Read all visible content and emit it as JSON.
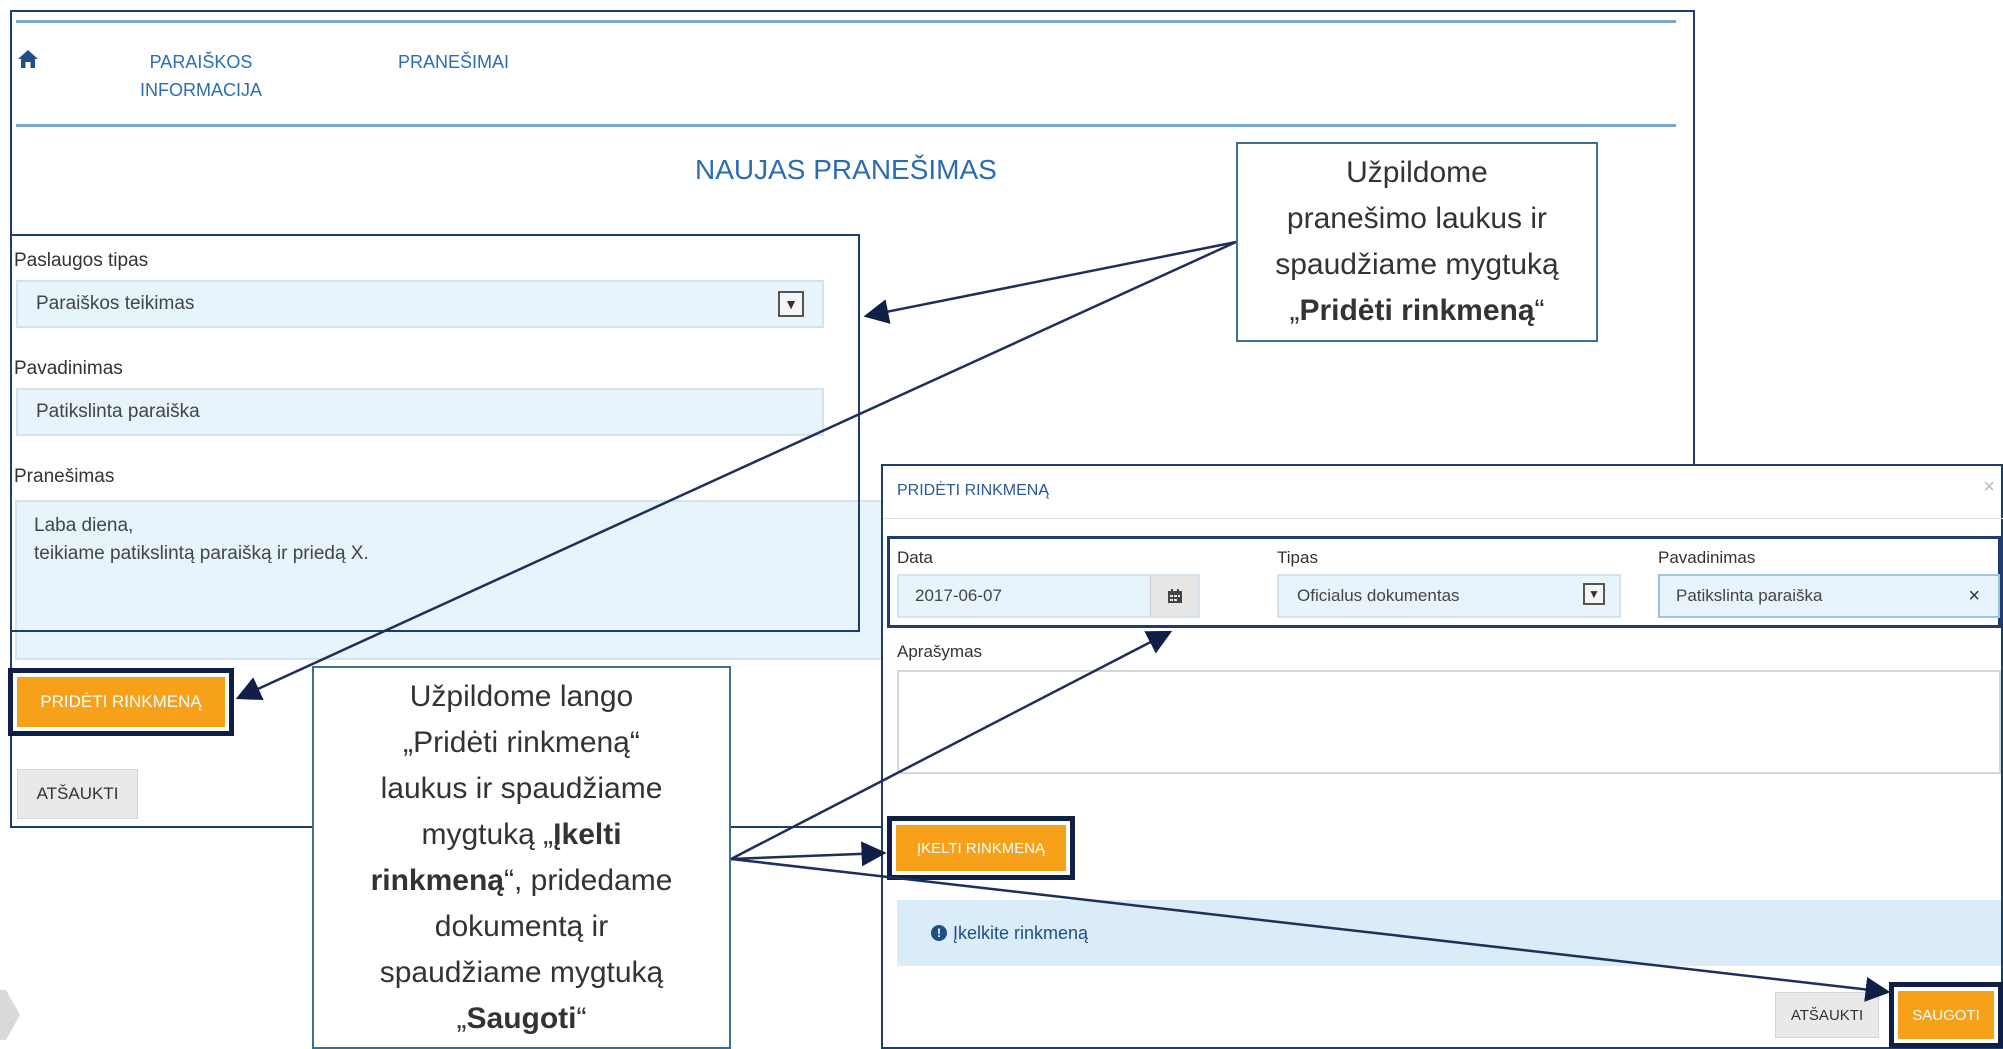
{
  "nav": {
    "home_icon": "home-icon",
    "items": [
      {
        "label_line1": "PARAIŠKOS",
        "label_line2": "INFORMACIJA"
      },
      {
        "label_line1": "PRANEŠIMAI"
      }
    ]
  },
  "page": {
    "title": "NAUJAS PRANEŠIMAS"
  },
  "form": {
    "service_type": {
      "label": "Paslaugos tipas",
      "value": "Paraiškos teikimas"
    },
    "name": {
      "label": "Pavadinimas",
      "value": "Patikslinta paraiška"
    },
    "message": {
      "label": "Pranešimas",
      "line1": "Laba diena,",
      "line2": "teikiame patikslintą paraišką ir priedą X."
    },
    "add_file_button": "PRIDĖTI RINKMENĄ",
    "cancel_button": "ATŠAUKTI"
  },
  "callouts": {
    "top": {
      "line1": "Užpildome",
      "line2": "pranešimo laukus ir",
      "line3": "spaudžiame mygtuką",
      "open_quote": "„",
      "bold": "Pridėti rinkmeną",
      "close_quote": "“"
    },
    "bottom": {
      "line1": "Užpildome lango",
      "line2": "„Pridėti rinkmeną“",
      "line3": "laukus ir spaudžiame",
      "line4_pre": "mygtuką „",
      "line4_bold": "Įkelti",
      "line5_bold": "rinkmeną",
      "line5_post": "“, pridedame",
      "line6": "dokumentą ir",
      "line7": "spaudžiame mygtuką",
      "line8_pre": "„",
      "line8_bold": "Saugoti",
      "line8_post": "“"
    }
  },
  "modal": {
    "title": "PRIDĖTI RINKMENĄ",
    "close_symbol": "×",
    "date": {
      "label": "Data",
      "value": "2017-06-07",
      "icon": "calendar-icon"
    },
    "type": {
      "label": "Tipas",
      "value": "Oficialus dokumentas"
    },
    "name": {
      "label": "Pavadinimas",
      "value": "Patikslinta paraiška",
      "clear_symbol": "×"
    },
    "description": {
      "label": "Aprašymas",
      "value": ""
    },
    "upload_button": "ĮKELTI RINKMENĄ",
    "info_icon": "info-circle-icon",
    "info_text": "Įkelkite rinkmeną",
    "cancel_button": "ATŠAUKTI",
    "save_button": "SAUGOTI"
  },
  "colors": {
    "accent_blue": "#2a6db5",
    "frame_navy": "#1f3c6e",
    "button_orange": "#f7a11a",
    "field_bg": "#e8f4fc",
    "info_bg": "#d9ecf7"
  }
}
